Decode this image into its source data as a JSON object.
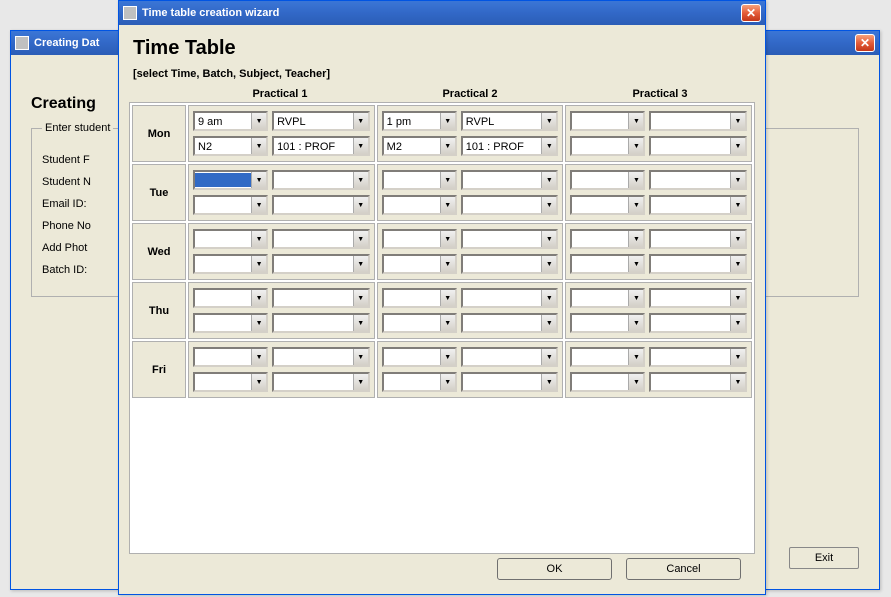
{
  "windows": {
    "back": {
      "title": "Creating Dat",
      "heading": "Creating",
      "fieldset_label": "Enter student",
      "fields": [
        "Student F",
        "Student N",
        "Email ID:",
        "Phone No",
        "Add Phot",
        "Batch ID:"
      ],
      "exit_label": "Exit"
    },
    "front": {
      "title": "Time table creation wizard",
      "heading": "Time Table",
      "subtitle": "[select Time, Batch, Subject, Teacher]",
      "columns": [
        "Practical 1",
        "Practical 2",
        "Practical 3"
      ],
      "days": [
        "Mon",
        "Tue",
        "Wed",
        "Thu",
        "Fri"
      ],
      "cells": {
        "mon_p1": {
          "time": "9 am",
          "subject": "RVPL",
          "batch": "N2",
          "teacher": "101 : PROF"
        },
        "mon_p2": {
          "time": "1 pm",
          "subject": "RVPL",
          "batch": "M2",
          "teacher": "101 : PROF"
        },
        "tue_p1_selected": true
      },
      "buttons": {
        "ok": "OK",
        "cancel": "Cancel"
      }
    }
  }
}
